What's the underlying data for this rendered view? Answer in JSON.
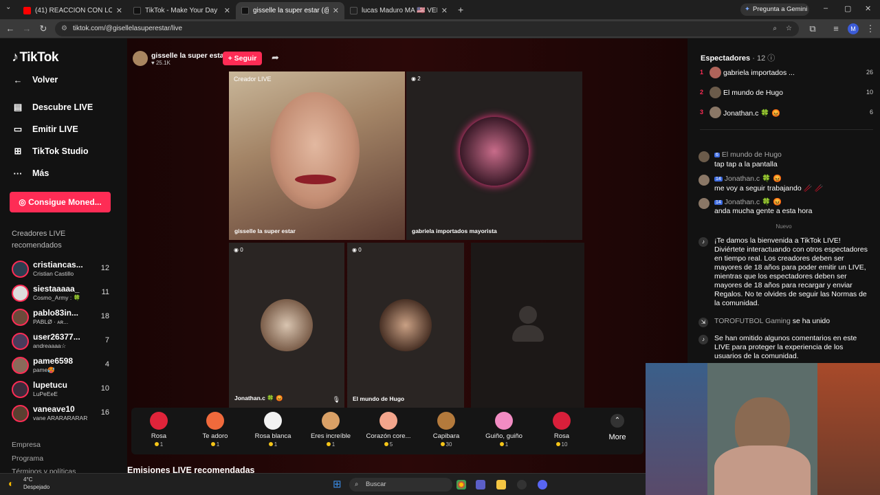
{
  "browser": {
    "tabs": [
      {
        "title": "(41) REACCIÓN CON LOS HINC",
        "fav_color": "#ff0000"
      },
      {
        "title": "TikTok - Make Your Day",
        "fav_color": "#111111"
      },
      {
        "title": "gisselle la super estar (@gi",
        "fav_color": "#111111"
      },
      {
        "title": "lucas Maduro MA 🇺🇸 VENXCN",
        "fav_color": "#222222"
      }
    ],
    "gemini_label": "Pregunta a Gemini",
    "url": "tiktok.com/@gisellelasuperestar/live",
    "profile_initial": "M"
  },
  "nav": {
    "logo": "TikTok",
    "back": "Volver",
    "items": [
      "Descubre LIVE",
      "Emitir LIVE",
      "TikTok Studio",
      "Más"
    ],
    "coins_button": "Consigue Moned...",
    "section_title": "Creadores LIVE recomendados",
    "creators": [
      {
        "name": "cristiancas...",
        "sub": "Cristian Castillo",
        "count": "12"
      },
      {
        "name": "siestaaaaa_",
        "sub": "Cosmo_Army : 🍀",
        "count": "11"
      },
      {
        "name": "pablo83in...",
        "sub": "PABLØ ·  ᴀʀ...",
        "count": "18"
      },
      {
        "name": "user26377...",
        "sub": "andreaaaa☆",
        "count": "7"
      },
      {
        "name": "pame6598",
        "sub": "pame🥵",
        "count": "4"
      },
      {
        "name": "lupetucu",
        "sub": "LuPeEeE",
        "count": "10"
      },
      {
        "name": "vaneave10",
        "sub": "vane ARARARARAR",
        "count": "16"
      }
    ],
    "footer": [
      "Empresa",
      "Programa",
      "Términos y políticas"
    ]
  },
  "host": {
    "name": "gisselle la super estar",
    "likes": "25.1K",
    "follow": "+ Seguir"
  },
  "tiles": {
    "main": {
      "badge": "Creador LIVE",
      "label": "gisselle la super estar"
    },
    "guest1": {
      "badge": "2",
      "label": "gabriela importados mayorista"
    },
    "guest2": {
      "badge": "0",
      "label": "Jonathan.c 🍀 😡"
    },
    "guest3": {
      "badge": "0",
      "label": "El mundo de Hugo"
    }
  },
  "gifts": [
    {
      "name": "Rosa",
      "price": "1",
      "color": "#e0243a"
    },
    {
      "name": "Te adoro",
      "price": "1",
      "color": "#f06a3c"
    },
    {
      "name": "Rosa blanca",
      "price": "1",
      "color": "#f2f2f2"
    },
    {
      "name": "Eres increíble",
      "price": "1",
      "color": "#d9a066"
    },
    {
      "name": "Corazón core...",
      "price": "5",
      "color": "#f3a58c"
    },
    {
      "name": "Capibara",
      "price": "30",
      "color": "#b47a3c"
    },
    {
      "name": "Guiño, guiño",
      "price": "1",
      "color": "#f28cc3"
    },
    {
      "name": "Rosa",
      "price": "10",
      "color": "#d81f3a"
    }
  ],
  "more_label": "More",
  "recommended_title": "Emisiones LIVE recomendadas",
  "viewers": {
    "title": "Espectadores",
    "count": "12",
    "list": [
      {
        "rank": "1",
        "name": "gabriela importados ...",
        "score": "26",
        "color": "#b0645a"
      },
      {
        "rank": "2",
        "name": "El mundo de Hugo",
        "score": "10",
        "color": "#6b5b4a"
      },
      {
        "rank": "3",
        "name": "Jonathan.c 🍀 😡",
        "score": "6",
        "color": "#8a7766"
      }
    ]
  },
  "chat": [
    {
      "name": "El mundo de Hugo",
      "level": "6",
      "text": "tap tap a la pantalla"
    },
    {
      "name": "Jonathan.c 🍀 😡",
      "level": "14",
      "text": "me voy a seguir trabajando 🥢 🥢"
    },
    {
      "name": "Jonathan.c 🍀 😡",
      "level": "14",
      "text": "anda mucha gente a esta hora"
    }
  ],
  "new_label": "Nuevo",
  "welcome_text": "¡Te damos la bienvenida a TikTok LIVE! Diviértete interactuando con otros espectadores en tiempo real. Los creadores deben ser mayores de 18 años para poder emitir un LIVE, mientras que los espectadores deben ser mayores de 18 años para recargar y enviar Regalos. No te olvides de seguir las Normas de la comunidad.",
  "joined": {
    "user": "TOROFUTBOL Gaming",
    "text": "se ha unido"
  },
  "omitted_text": "Se han omitido algunos comentarios en este LIVE para proteger la experiencia de los usuarios de la comunidad.",
  "taskbar": {
    "temp": "4°C",
    "weather": "Despejado",
    "search": "Buscar"
  }
}
